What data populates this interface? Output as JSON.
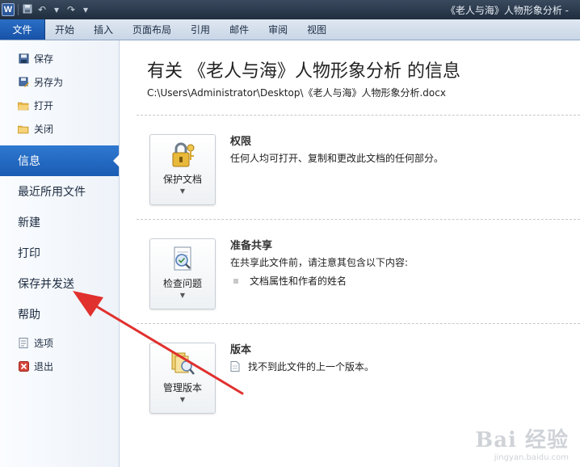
{
  "window": {
    "title": "《老人与海》人物形象分析 -"
  },
  "qat": {
    "logo": "W",
    "save_icon": "save-icon",
    "undo": "↶",
    "redo": "↷"
  },
  "ribbon": {
    "file_tab": "文件",
    "tabs": [
      "开始",
      "插入",
      "页面布局",
      "引用",
      "邮件",
      "审阅",
      "视图"
    ]
  },
  "sidebar": {
    "items": [
      {
        "label": "保存",
        "kind": "small",
        "icon": "save-icon"
      },
      {
        "label": "另存为",
        "kind": "small",
        "icon": "save-as-icon"
      },
      {
        "label": "打开",
        "kind": "small",
        "icon": "open-folder-icon"
      },
      {
        "label": "关闭",
        "kind": "small",
        "icon": "close-folder-icon"
      },
      {
        "label": "信息",
        "kind": "big",
        "active": true
      },
      {
        "label": "最近所用文件",
        "kind": "big"
      },
      {
        "label": "新建",
        "kind": "big"
      },
      {
        "label": "打印",
        "kind": "big"
      },
      {
        "label": "保存并发送",
        "kind": "big"
      },
      {
        "label": "帮助",
        "kind": "big"
      },
      {
        "label": "选项",
        "kind": "small",
        "icon": "options-icon"
      },
      {
        "label": "退出",
        "kind": "small",
        "icon": "exit-icon"
      }
    ]
  },
  "info": {
    "title": "有关 《老人与海》人物形象分析 的信息",
    "path": "C:\\Users\\Administrator\\Desktop\\《老人与海》人物形象分析.docx"
  },
  "sections": {
    "permissions": {
      "button_label": "保护文档",
      "heading": "权限",
      "text": "任何人均可打开、复制和更改此文档的任何部分。"
    },
    "prepare": {
      "button_label": "检查问题",
      "heading": "准备共享",
      "text": "在共享此文件前，请注意其包含以下内容:",
      "bullet": "文档属性和作者的姓名"
    },
    "versions": {
      "button_label": "管理版本",
      "heading": "版本",
      "bullet": "找不到此文件的上一个版本。"
    }
  },
  "watermark": {
    "brand": "Bai 经验",
    "url": "jingyan.baidu.com"
  },
  "colors": {
    "accent": "#1a5cb3",
    "annotation": "#e0312f"
  }
}
